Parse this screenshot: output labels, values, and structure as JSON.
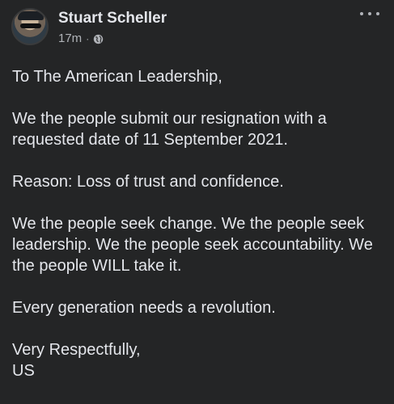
{
  "post": {
    "author_name": "Stuart Scheller",
    "time": "17m",
    "separator": "·",
    "privacy_icon": "globe-icon",
    "more_icon": "more-options-icon"
  },
  "content": {
    "paragraphs": [
      "To The American Leadership,",
      "We the people submit our resignation with a requested date of 11 September 2021.",
      "Reason: Loss of trust and confidence.",
      "We the people seek change.  We the people seek leadership.  We the people seek accountability.  We the people WILL take it.",
      "Every generation needs a revolution."
    ],
    "signoff_line1": "Very Respectfully,",
    "signoff_line2": "US"
  },
  "colors": {
    "background": "#242526",
    "primary_text": "#e4e6eb",
    "secondary_text": "#b0b3b8"
  }
}
